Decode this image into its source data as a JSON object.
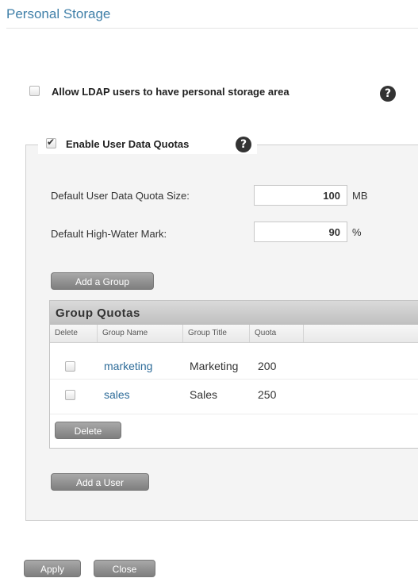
{
  "page": {
    "title": "Personal Storage"
  },
  "ldap": {
    "label": "Allow LDAP users to have personal storage area",
    "checked": false
  },
  "quotas": {
    "label": "Enable User Data Quotas",
    "checked": true,
    "default_size_label": "Default User Data Quota Size:",
    "default_size_value": "100",
    "default_size_unit": "MB",
    "hwm_label": "Default High-Water Mark:",
    "hwm_value": "90",
    "hwm_unit": "%",
    "add_group_label": "Add a Group",
    "add_user_label": "Add a User"
  },
  "group_table": {
    "title": "Group Quotas",
    "columns": [
      "Delete",
      "Group Name",
      "Group Title",
      "Quota"
    ],
    "rows": [
      {
        "name": "marketing",
        "title": "Marketing",
        "quota": "200"
      },
      {
        "name": "sales",
        "title": "Sales",
        "quota": "250"
      }
    ],
    "delete_label": "Delete"
  },
  "footer": {
    "apply_label": "Apply",
    "close_label": "Close"
  },
  "icons": {
    "help": "question-mark-icon"
  },
  "colors": {
    "title": "#3f7fa8",
    "link": "#2e6c99",
    "button": "#8f8f8f"
  }
}
